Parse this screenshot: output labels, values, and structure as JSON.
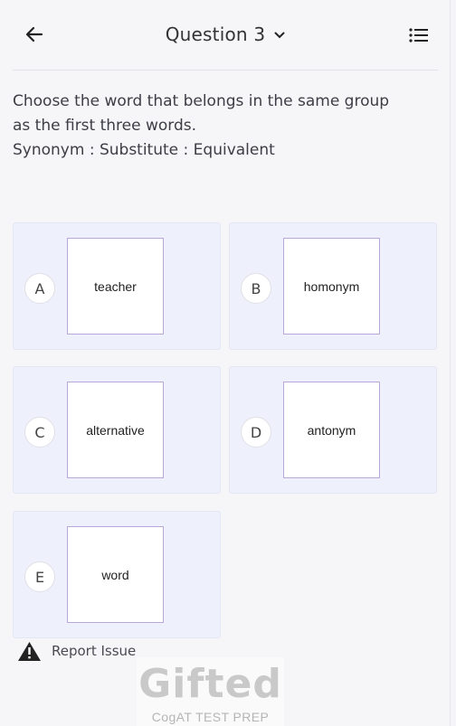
{
  "header": {
    "title": "Question 3",
    "back_icon": "arrow-left-icon",
    "dropdown_icon": "chevron-down-icon",
    "list_icon": "list-icon"
  },
  "question": {
    "line1": "Choose the word that belongs in the same group",
    "line2": "as the first three words.",
    "line3": "Synonym : Substitute : Equivalent"
  },
  "options": [
    {
      "letter": "A",
      "word": "teacher"
    },
    {
      "letter": "B",
      "word": "homonym"
    },
    {
      "letter": "C",
      "word": "alternative"
    },
    {
      "letter": "D",
      "word": "antonym"
    },
    {
      "letter": "E",
      "word": "word"
    }
  ],
  "report": {
    "label": "Report Issue",
    "icon": "warning-icon"
  },
  "logo": {
    "brand": "Gifted",
    "tagline": "CogAT TEST PREP"
  },
  "colors": {
    "option_bg": "#eef0fb",
    "card_border": "#b7a8d8"
  }
}
